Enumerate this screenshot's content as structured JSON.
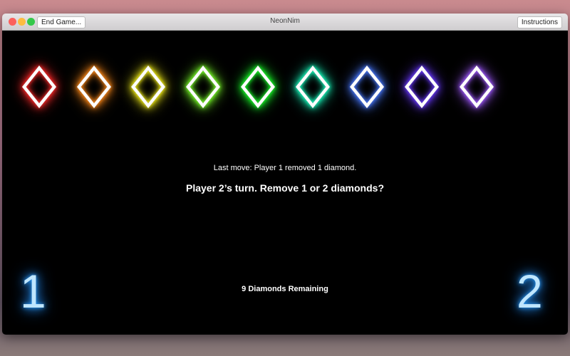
{
  "window": {
    "title": "NeonNim",
    "end_game_label": "End Game...",
    "instructions_label": "Instructions"
  },
  "diamonds": [
    {
      "color": "#ff2a2a"
    },
    {
      "color": "#ff8a1a"
    },
    {
      "color": "#f5f01a"
    },
    {
      "color": "#7aff2a"
    },
    {
      "color": "#1aff2a"
    },
    {
      "color": "#1affc0"
    },
    {
      "color": "#4a7aff"
    },
    {
      "color": "#6a3aff"
    },
    {
      "color": "#a05aff"
    }
  ],
  "status": {
    "last_move": "Last move: Player 1 removed 1 diamond.",
    "prompt": "Player 2’s turn. Remove 1 or 2 diamonds?",
    "remaining": "9 Diamonds Remaining"
  },
  "players": {
    "p1": "1",
    "p2": "2"
  }
}
